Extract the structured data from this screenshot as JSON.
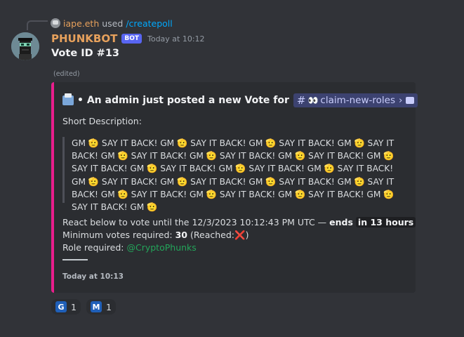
{
  "reply": {
    "username": "iape.eth",
    "used_text": "used",
    "command": "/createpoll"
  },
  "message": {
    "bot_name": "PHUNKBOT",
    "bot_tag": "BOT",
    "timestamp": "Today at 10:12",
    "title": "Vote ID #13",
    "edited": "(edited)"
  },
  "embed": {
    "accent_color": "#e91e8c",
    "title_prefix": "• An admin just posted a new Vote for",
    "channel_hash": "#",
    "channel_emoji": "👀",
    "channel_name": "claim-new-roles",
    "channel_chevron": "›",
    "short_description_label": "Short Description:",
    "description_text": "GM 🫡 SAY IT BACK! GM 🫡 SAY IT BACK! GM 🫡 SAY IT BACK! GM 🫡 SAY IT BACK! GM 🫡 SAY IT BACK! GM 🫡 SAY IT BACK! GM 🫡 SAY IT BACK! GM 🫡 SAY IT BACK! GM 🫡 SAY IT BACK! GM 🫡 SAY IT BACK! GM 🫡 SAY IT BACK! GM 🫡 SAY IT BACK! GM 🫡 SAY IT BACK! GM 🫡 SAY IT BACK! GM 🫡 SAY IT BACK! GM 🫡 SAY IT BACK! GM 🫡 SAY IT BACK! GM 🫡 SAY IT BACK! GM 🫡 SAY IT BACK! GM 🫡",
    "react_text": "React below to vote until the 12/3/2023 10:12:43 PM UTC —",
    "ends_label": "ends",
    "ends_value": "in 13 hours",
    "min_votes_label": "Minimum votes required:",
    "min_votes_value": "30",
    "reached_label": "(Reached:",
    "reached_icon": "❌",
    "reached_close": ")",
    "role_label": "Role required:",
    "role_mention": "@CryptoPhunks",
    "divider": "———",
    "footer_timestamp": "Today at 10:13"
  },
  "reactions": [
    {
      "icon": "G",
      "icon_name": "letter-g-emoji",
      "count": "1"
    },
    {
      "icon": "M",
      "icon_name": "letter-m-emoji",
      "count": "1"
    }
  ]
}
